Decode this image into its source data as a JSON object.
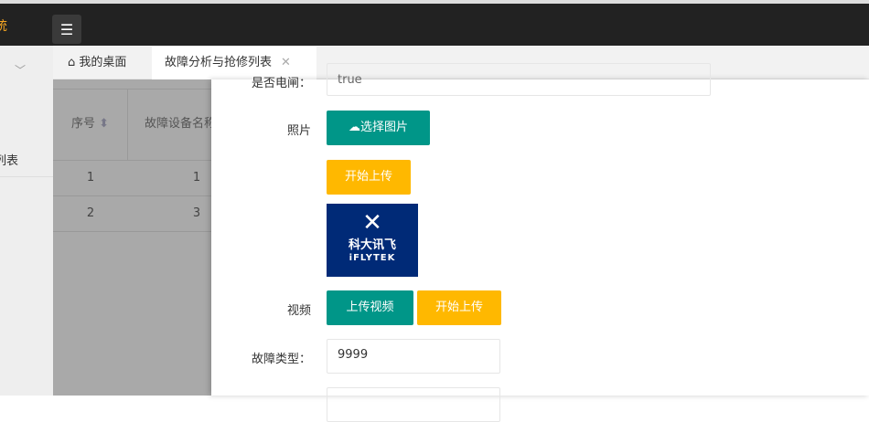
{
  "header": {
    "logo_text": "统",
    "menu_icon": "list-icon"
  },
  "sidebar": {
    "item_label": "列表"
  },
  "tabs": [
    {
      "label": "我的桌面"
    },
    {
      "label": "故障分析与抢修列表"
    }
  ],
  "table": {
    "headers": [
      "序号",
      "故障设备名称"
    ],
    "rows": [
      [
        "1",
        "1"
      ],
      [
        "2",
        "3"
      ]
    ]
  },
  "form": {
    "partial_label": "是否电闸：",
    "partial_value": "true",
    "photo_label": "照片",
    "choose_image": "选择图片",
    "start_upload": "开始上传",
    "image_text_cn": "科大讯飞",
    "image_text_en": "iFLYTEK",
    "video_label": "视频",
    "upload_video": "上传视频",
    "start_upload_video": "开始上传",
    "fault_type_label": "故障类型：",
    "fault_type_value": "9999"
  },
  "colors": {
    "teal": "#009688",
    "yellow": "#FFB800",
    "header": "#222222"
  }
}
